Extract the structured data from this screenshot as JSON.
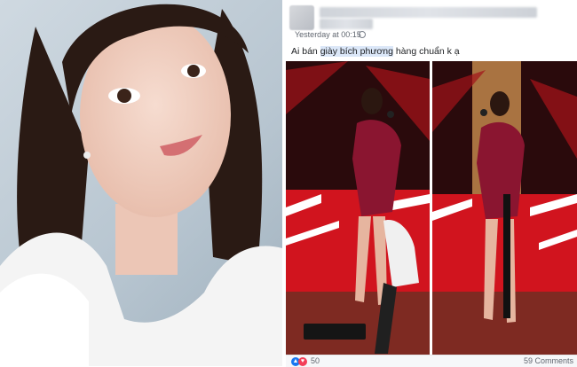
{
  "post": {
    "timestamp": "Yesterday at 00:15",
    "caption_before": "Ai bán ",
    "caption_highlight": "giày bích phương",
    "caption_after": " hàng chuẩn k ạ"
  },
  "footer": {
    "reaction_count": "50",
    "comment_count": "59 Comments"
  },
  "icons": [
    "globe-icon",
    "like-icon",
    "love-icon"
  ],
  "colors": {
    "link_highlight": "#dbe7f8",
    "stage_red": "#d1141e",
    "dress": "#8a1530",
    "like_blue": "#1877f2",
    "love_red": "#f33e58"
  }
}
